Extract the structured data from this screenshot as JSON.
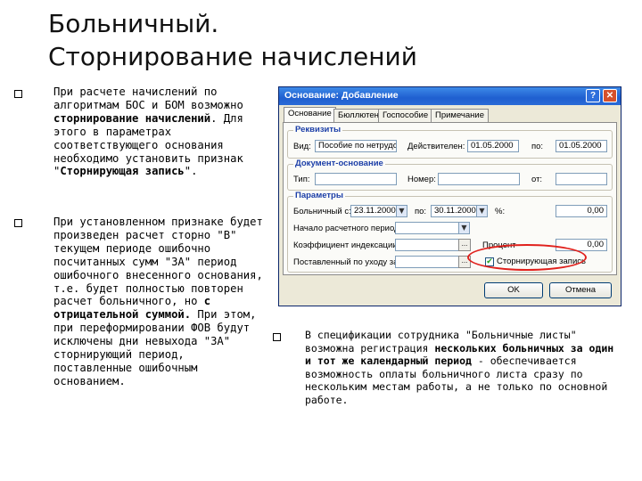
{
  "slide": {
    "title_line1": "Больничный.",
    "title_line2": "Сторнирование начислений"
  },
  "bullets_left": [
    {
      "segments": [
        {
          "text": "При расчете начислений по алгоритмам БОС и БОМ возможно ",
          "bold": false
        },
        {
          "text": "сторнирование начислений",
          "bold": true
        },
        {
          "text": ". Для этого в параметрах соответствующего основания необходимо установить признак \"",
          "bold": false
        },
        {
          "text": "Сторнирующая запись",
          "bold": true
        },
        {
          "text": "\".",
          "bold": false
        }
      ]
    },
    {
      "segments": [
        {
          "text": "При установленном признаке будет произведен расчет сторно \"В\" текущем периоде ошибочно посчитанных сумм \"ЗА\" период ошибочного внесенного основания, т.е. будет полностью повторен расчет больничного, но ",
          "bold": false
        },
        {
          "text": "с отрицательной суммой.",
          "bold": true
        },
        {
          "text": " При этом, при переформировании ФОВ будут исключены дни невыхода \"ЗА\" сторнирующий период, поставленные ошибочным основанием.",
          "bold": false
        }
      ]
    }
  ],
  "bullet_right": {
    "segments": [
      {
        "text": "В спецификации сотрудника \"Больничные листы\" возможна регистрация ",
        "bold": false
      },
      {
        "text": "нескольких больничных за один и тот же календарный период",
        "bold": true
      },
      {
        "text": " - обеспечивается возможность оплаты больничного листа сразу по нескольким местам работы, а не только по основной работе.",
        "bold": false
      }
    ]
  },
  "dialog": {
    "title": "Основание: Добавление",
    "help_label": "?",
    "close_label": "✕",
    "tabs": [
      "Основание",
      "Бюллютень",
      "Госпособие",
      "Примечание"
    ],
    "active_tab": 0,
    "group_requisites": {
      "label": "Реквизиты",
      "vid_label": "Вид:",
      "vid_value": "Пособие по нетрудоспо",
      "period_label": "Действителен:",
      "from_value": "01.05.2000",
      "to_label": "по:",
      "to_value": "01.05.2000"
    },
    "group_document": {
      "label": "Документ-основание",
      "type_label": "Тип:",
      "number_label": "Номер:",
      "from_label": "от:"
    },
    "group_params": {
      "label": "Параметры",
      "sick_label": "Больничный с:",
      "sick_from": "23.11.2000",
      "sick_to_label": "по:",
      "sick_to": "30.11.2000",
      "pct_label": "%:",
      "pct_value": "0,00",
      "period_start_label": "Начало расчетного периода:",
      "dots_label": "...",
      "coef_label": "Коэффициент индексации:",
      "coef_value": "",
      "percent_label": "Процент",
      "percent_value": "0,00",
      "care_label": "Поставленный по уходу за:",
      "storno_label": "Сторнирующая запись",
      "storno_checked": true,
      "storno_mark": "✔"
    },
    "buttons": {
      "ok": "OK",
      "cancel": "Отмена"
    }
  }
}
